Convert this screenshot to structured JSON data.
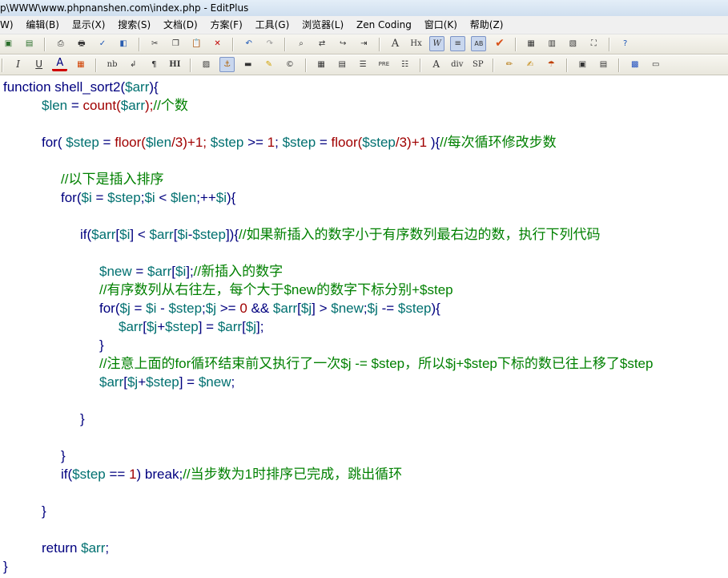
{
  "window": {
    "title": "p\\WWW\\www.phpnanshen.com\\index.php - EditPlus"
  },
  "menu": [
    "W)",
    "编辑(B)",
    "显示(X)",
    "搜索(S)",
    "文档(D)",
    "方案(F)",
    "工具(G)",
    "浏览器(L)",
    "Zen Coding",
    "窗口(K)",
    "帮助(Z)"
  ],
  "toolbar1": [
    "save-icon",
    "save-all-icon",
    "print-preview-icon",
    "print-icon",
    "spellcheck-icon",
    "browser-icon",
    "cut-icon",
    "copy-icon",
    "paste-icon",
    "delete-icon",
    "undo-icon",
    "redo-icon",
    "find-icon",
    "replace-icon",
    "goto-icon",
    "indent-icon",
    "font-icon",
    "hex-icon",
    "wordwrap-icon",
    "linenumber-icon",
    "ruler-icon",
    "check-icon",
    "cliptext-icon",
    "directory-icon",
    "output-icon",
    "fullscreen-icon",
    "help-icon"
  ],
  "toolbar2": [
    "italic-icon",
    "underline-icon",
    "font-color-icon",
    "color-icon",
    "nbsp-icon",
    "br-icon",
    "para-icon",
    "hr-icon",
    "image-icon",
    "anchor-icon",
    "list-icon",
    "highlight-icon",
    "copyright-icon",
    "table-icon",
    "form-icon",
    "center-icon",
    "pre-icon",
    "numbered-list-icon",
    "a-tag-icon",
    "div-tag-icon",
    "span-tag-icon",
    "edit-icon",
    "style-icon",
    "script-icon",
    "frame-icon",
    "select-icon",
    "color-picker-icon",
    "window-icon"
  ],
  "toolbar2_text": {
    "hx": "Hx",
    "nb": "nb",
    "div": "div",
    "sp": "SP",
    "pre": "PRE",
    "hi": "HI"
  },
  "code": {
    "l1": {
      "kw": "function shell_sort2(",
      "v1": "$arr",
      "end": "){"
    },
    "l2": {
      "v1": "$len",
      "eq": " = ",
      "fn": "count(",
      "v2": "$arr",
      "end": ");",
      "c": "//个数"
    },
    "l3": {
      "kw": "for( ",
      "v1": "$step",
      "eq": " = ",
      "fn": "floor(",
      "v2": "$len",
      "n1": "/3)+1; ",
      "v3": "$step",
      "op": " >= ",
      "n2": "1",
      "semi": "; ",
      "v4": "$step",
      "eq2": " = ",
      "fn2": "floor(",
      "v5": "$step",
      "n3": "/3)+1 ",
      "end": "){",
      "c": "//每次循环修改步数"
    },
    "l4": {
      "c": "//以下是插入排序"
    },
    "l5": {
      "kw": "for(",
      "v1": "$i",
      "eq": " = ",
      "v2": "$step",
      "semi": ";",
      "v3": "$i",
      "op": " < ",
      "v4": "$len",
      "inc": ";++",
      "v5": "$i",
      "end": "){"
    },
    "l6": {
      "kw": "if(",
      "v1": "$arr",
      "b1": "[",
      "v2": "$i",
      "b2": "] < ",
      "v3": "$arr",
      "b3": "[",
      "v4": "$i",
      "minus": "-",
      "v5": "$step",
      "end": "]){",
      "c": "//如果新插入的数字小于有序数列最右边的数，执行下列代码"
    },
    "l7": {
      "v1": "$new",
      "eq": " = ",
      "v2": "$arr",
      "b1": "[",
      "v3": "$i",
      "end": "];",
      "c": "//新插入的数字"
    },
    "l8": {
      "c": "//有序数列从右往左，每个大于$new的数字下标分别+$step"
    },
    "l9": {
      "kw": "for(",
      "v1": "$j",
      "eq": " = ",
      "v2": "$i",
      "minus": " - ",
      "v3": "$step",
      "semi": ";",
      "v4": "$j",
      "op": " >= ",
      "n1": "0",
      "and": " && ",
      "v5": "$arr",
      "b1": "[",
      "v6": "$j",
      "b2": "] > ",
      "v7": "$new",
      "semi2": ";",
      "v8": "$j",
      "op2": " -= ",
      "v9": "$step",
      "end": "){"
    },
    "l10": {
      "v1": "$arr",
      "b1": "[",
      "v2": "$j",
      "plus": "+",
      "v3": "$step",
      "b2": "] = ",
      "v4": "$arr",
      "b3": "[",
      "v5": "$j",
      "end": "];"
    },
    "l11": {
      "t": "}"
    },
    "l12": {
      "c": "//注意上面的for循环结束前又执行了一次$j -= $step，所以$j+$step下标的数已往上移了$step"
    },
    "l13": {
      "v1": "$arr",
      "b1": "[",
      "v2": "$j",
      "plus": "+",
      "v3": "$step",
      "b2": "] = ",
      "v4": "$new",
      "end": ";"
    },
    "l14": {
      "t": "}"
    },
    "l15": {
      "t": "}"
    },
    "l16": {
      "kw": "if(",
      "v1": "$step",
      "op": " == ",
      "n1": "1",
      "end": ") break;",
      "c": "//当步数为1时排序已完成，跳出循环"
    },
    "l17": {
      "t": "}"
    },
    "l18": {
      "kw": "return ",
      "v1": "$arr",
      "end": ";"
    },
    "l19": {
      "t": "}"
    }
  }
}
